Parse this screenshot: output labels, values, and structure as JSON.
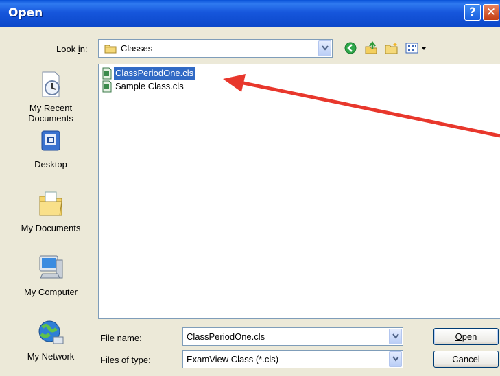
{
  "dialog": {
    "title": "Open",
    "help_glyph": "?",
    "close_glyph": "✕"
  },
  "look_in": {
    "label_prefix": "Look ",
    "label_accel": "i",
    "label_suffix": "n:",
    "value": "Classes",
    "folder_icon": "folder-icon"
  },
  "toolbar": {
    "icons": [
      "back-icon",
      "up-folder-icon",
      "new-folder-icon",
      "views-menu-icon"
    ]
  },
  "places": [
    {
      "line1": "My Recent",
      "line2": "Documents",
      "icon": "recent-documents-icon"
    },
    {
      "line1": "Desktop",
      "line2": "",
      "icon": "desktop-icon"
    },
    {
      "line1": "My Documents",
      "line2": "",
      "icon": "my-documents-icon"
    },
    {
      "line1": "My Computer",
      "line2": "",
      "icon": "my-computer-icon"
    },
    {
      "line1": "My Network",
      "line2": "",
      "icon": "my-network-icon"
    }
  ],
  "files": [
    {
      "name": "ClassPeriodOne.cls",
      "selected": true
    },
    {
      "name": "Sample Class.cls",
      "selected": false
    }
  ],
  "file_name": {
    "label_prefix": "File ",
    "label_accel": "n",
    "label_suffix": "ame:",
    "value": "ClassPeriodOne.cls"
  },
  "file_type": {
    "label_prefix": "Files of ",
    "label_accel": "t",
    "label_suffix": "ype:",
    "value": "ExamView Class (*.cls)"
  },
  "buttons": {
    "open_accel": "O",
    "open_rest": "pen",
    "cancel": "Cancel"
  },
  "colors": {
    "titlebar": "#0b47c9",
    "selection": "#316ac5",
    "annotation_arrow": "#e8372c"
  }
}
